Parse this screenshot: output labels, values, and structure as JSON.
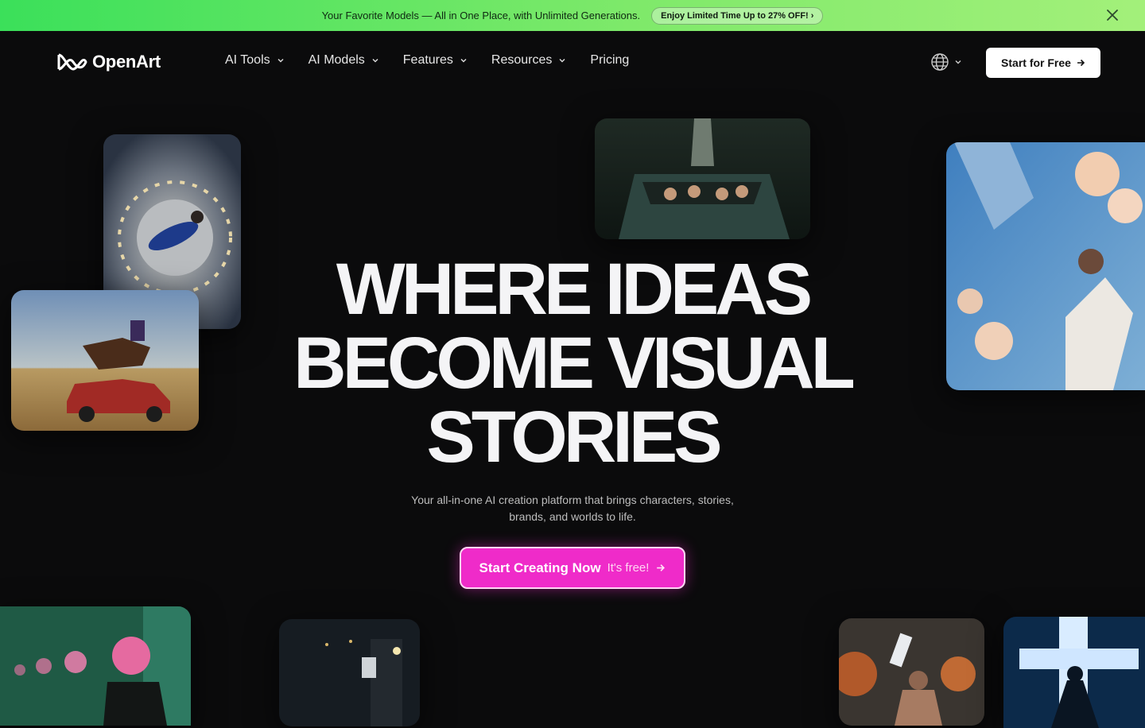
{
  "promo": {
    "text": "Your Favorite Models — All in One Place, with Unlimited Generations.",
    "pill": "Enjoy Limited Time Up to 27% OFF! ›"
  },
  "nav": {
    "logo": "OpenArt",
    "items": [
      {
        "label": "AI Tools",
        "dropdown": true
      },
      {
        "label": "AI Models",
        "dropdown": true
      },
      {
        "label": "Features",
        "dropdown": true
      },
      {
        "label": "Resources",
        "dropdown": true
      },
      {
        "label": "Pricing",
        "dropdown": false
      }
    ],
    "cta": "Start for Free"
  },
  "hero": {
    "title_lines": [
      "WHERE IDEAS",
      "BECOME VISUAL",
      "STORIES"
    ],
    "subtitle": "Your all-in-one AI creation platform that brings characters, stories, brands, and worlds to life.",
    "cta_main": "Start Creating Now",
    "cta_sub": "It's free!"
  },
  "colors": {
    "promo_start": "#3be05a",
    "promo_end": "#a3f07a",
    "background": "#0b0b0c",
    "cta_pink": "#ef2bc9"
  },
  "icons": [
    "openart-logo-icon",
    "chevron-down-icon",
    "globe-icon",
    "arrow-right-icon",
    "close-icon"
  ]
}
